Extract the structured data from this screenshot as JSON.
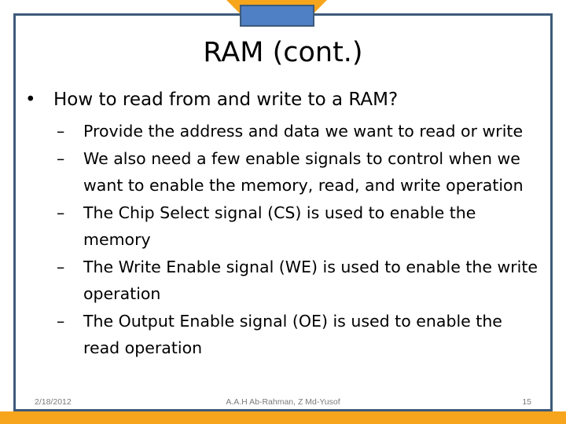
{
  "slide": {
    "title": "RAM (cont.)",
    "bullets": [
      {
        "text": "How to read from and write to a RAM?",
        "bullet_glyph": "•",
        "sub_items": [
          {
            "dash": "–",
            "text": "Provide the address and data we want to read or write"
          },
          {
            "dash": "–",
            "text": "We also need a few enable signals to control when we want to enable the memory, read, and write operation"
          },
          {
            "dash": "–",
            "text": "The Chip Select signal (CS) is used to enable the memory"
          },
          {
            "dash": "–",
            "text": "The Write Enable signal (WE) is used to enable the write operation"
          },
          {
            "dash": "–",
            "text": "The Output Enable signal (OE) is used to enable the read operation"
          }
        ]
      }
    ]
  },
  "footer": {
    "date": "2/18/2012",
    "author": "A.A.H Ab-Rahman, Z Md-Yusof",
    "page_number": "15"
  },
  "theme": {
    "accent_orange": "#F7A51D",
    "frame_blue": "#3E5A7A",
    "tab_blue": "#4F7FC4"
  }
}
